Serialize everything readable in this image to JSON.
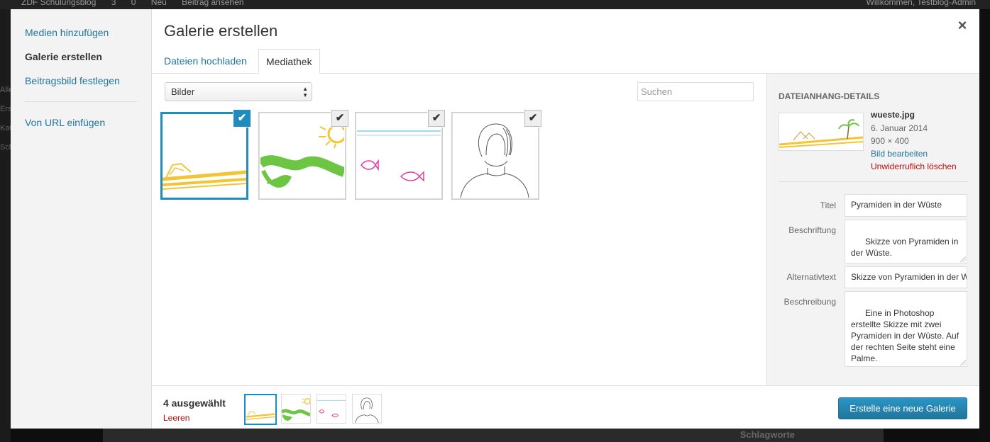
{
  "backdrop": {
    "admin_bar_left": [
      "ZDF Schulungsblog",
      "3",
      "0",
      "Neu",
      "Beitrag ansehen"
    ],
    "admin_bar_right": "Willkommen, Testblog-Admin",
    "side_labels": [
      "Alle",
      "Ers",
      "Kat",
      "Sch"
    ],
    "widget_title": "Schlagworte"
  },
  "menu": {
    "items": [
      "Medien hinzufügen",
      "Galerie erstellen",
      "Beitragsbild festlegen",
      "Von URL einfügen"
    ]
  },
  "title": "Galerie erstellen",
  "close_icon": "×",
  "tabs": [
    "Dateien hochladen",
    "Mediathek"
  ],
  "filter": {
    "selected": "Bilder"
  },
  "search": {
    "placeholder": "Suchen",
    "value": ""
  },
  "attachments": [
    {
      "name": "wueste",
      "selected": true,
      "focused": true
    },
    {
      "name": "gruen-sonne",
      "selected": true
    },
    {
      "name": "fische",
      "selected": true
    },
    {
      "name": "portrait",
      "selected": true
    }
  ],
  "check_icon": "✔",
  "details": {
    "heading": "Dateianhang-Details",
    "filename": "wueste.jpg",
    "date": "6. Januar 2014",
    "dimensions": "900 × 400",
    "edit_link": "Bild bearbeiten",
    "delete_link": "Unwiderruflich löschen",
    "fields": {
      "title_label": "Titel",
      "title_value": "Pyramiden in der Wüste",
      "caption_label": "Beschriftung",
      "caption_value": "Skizze von Pyramiden in der Wüste.",
      "alt_label": "Alternativtext",
      "alt_value": "Skizze von Pyramiden in der Wüste.",
      "desc_label": "Beschreibung",
      "desc_value": "Eine in Photoshop erstellte Skizze mit zwei Pyramiden in der Wüste. Auf der rechten Seite steht eine Palme."
    }
  },
  "toolbar": {
    "selected_count": "4 ausgewählt",
    "clear_label": "Leeren",
    "create_button": "Erstelle eine neue Galerie"
  },
  "colors": {
    "accent": "#1e8cbe",
    "link": "#21759b",
    "danger": "#bc0b0b",
    "sand": "#f3c536",
    "grass": "#6cc644",
    "pink": "#e040a0"
  }
}
